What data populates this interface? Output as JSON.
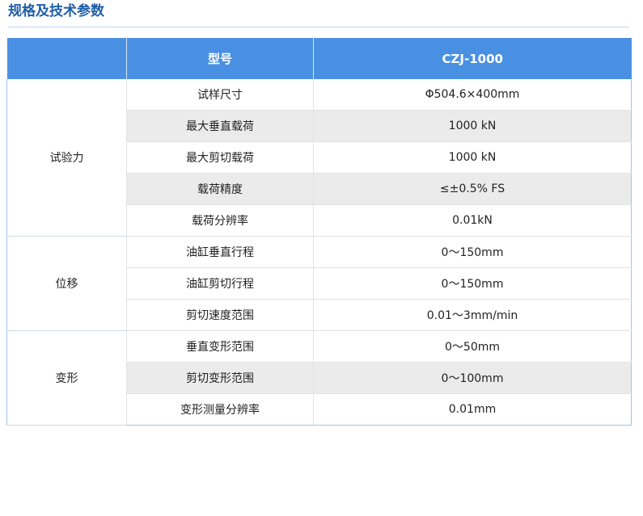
{
  "header": {
    "title": "规格及技术参数"
  },
  "table": {
    "columns": [
      "",
      "型号",
      "CZJ-1000"
    ],
    "groups": [
      {
        "name": "试验力",
        "rows": [
          {
            "param": "试样尺寸",
            "value": "Φ504.6×400mm"
          },
          {
            "param": "最大垂直载荷",
            "value": "1000 kN"
          },
          {
            "param": "最大剪切载荷",
            "value": "1000 kN"
          },
          {
            "param": "载荷精度",
            "value": "≤±0.5% FS"
          },
          {
            "param": "载荷分辨率",
            "value": "0.01kN"
          }
        ]
      },
      {
        "name": "位移",
        "rows": [
          {
            "param": "油缸垂直行程",
            "value": "0～150mm"
          },
          {
            "param": "油缸剪切行程",
            "value": "0～150mm"
          },
          {
            "param": "剪切速度范围",
            "value": "0.01～3mm/min"
          }
        ]
      },
      {
        "name": "变形",
        "rows": [
          {
            "param": "垂直变形范围",
            "value": "0～50mm"
          },
          {
            "param": "剪切变形范围",
            "value": "0～100mm"
          },
          {
            "param": "变形测量分辨率",
            "value": "0.01mm"
          }
        ]
      }
    ]
  },
  "colors": {
    "accent": "#4a90e2",
    "title": "#1f5fa8",
    "row_shade": "#ebebeb"
  }
}
